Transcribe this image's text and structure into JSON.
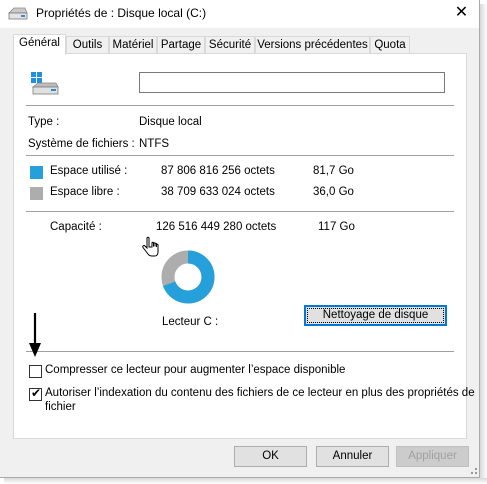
{
  "window": {
    "title": "Propriétés de : Disque local (C:)",
    "close_glyph": "✕"
  },
  "tabs": [
    {
      "label": "Général",
      "active": true
    },
    {
      "label": "Outils"
    },
    {
      "label": "Matériel"
    },
    {
      "label": "Partage"
    },
    {
      "label": "Sécurité"
    },
    {
      "label": "Versions précédentes"
    },
    {
      "label": "Quota"
    }
  ],
  "general": {
    "name_value": "",
    "type_label": "Type :",
    "type_value": "Disque local",
    "fs_label": "Système de fichiers :",
    "fs_value": "NTFS",
    "used": {
      "label": "Espace utilisé :",
      "bytes": "87 806 816 256 octets",
      "size": "81,7 Go",
      "color": "#26a0da"
    },
    "free": {
      "label": "Espace libre :",
      "bytes": "38 709 633 024 octets",
      "size": "36,0 Go",
      "color": "#adadad"
    },
    "capacity": {
      "label": "Capacité :",
      "bytes": "126 516 449 280 octets",
      "size": "117 Go"
    },
    "drive_label": "Lecteur C :",
    "cleanup_button": "Nettoyage de disque",
    "used_fraction": 0.694
  },
  "options": {
    "compress": {
      "label": "Compresser ce lecteur pour augmenter l’espace disponible",
      "checked": false
    },
    "index": {
      "label_line1": "Autoriser l’indexation du contenu des fichiers de ce lecteur en plus des propriétés de",
      "label_line2": "fichier",
      "checked": true
    }
  },
  "buttons": {
    "ok": "OK",
    "cancel": "Annuler",
    "apply": "Appliquer"
  }
}
